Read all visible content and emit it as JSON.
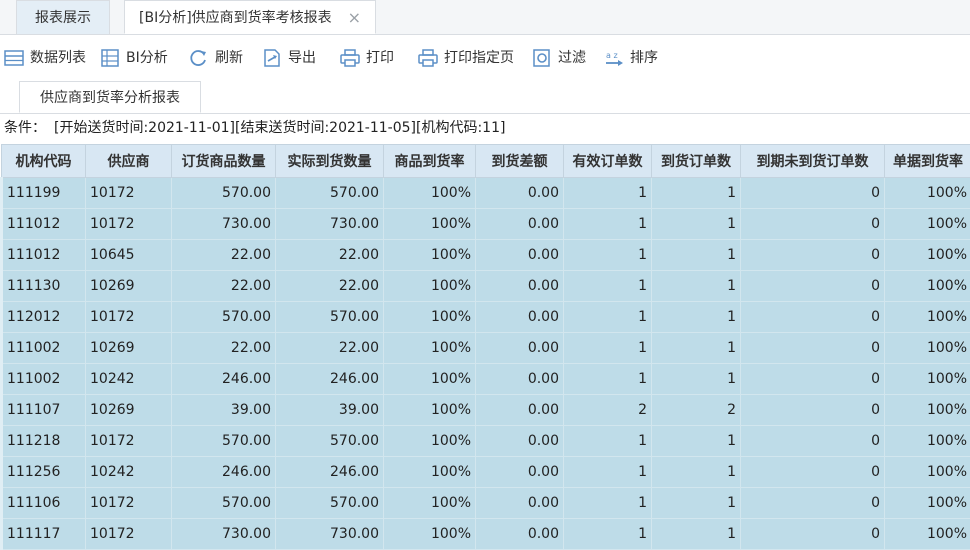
{
  "tabs": [
    {
      "label": "报表展示"
    },
    {
      "label": "[BI分析]供应商到货率考核报表",
      "close": "×"
    }
  ],
  "toolbar": {
    "items": [
      {
        "label": "数据列表",
        "icon": "table-list-icon"
      },
      {
        "label": "BI分析",
        "icon": "grid-icon"
      },
      {
        "label": "刷新",
        "icon": "refresh-icon"
      },
      {
        "label": "导出",
        "icon": "export-icon"
      },
      {
        "label": "打印",
        "icon": "print-icon"
      },
      {
        "label": "打印指定页",
        "icon": "print-pages-icon"
      },
      {
        "label": "过滤",
        "icon": "filter-icon"
      },
      {
        "label": "排序",
        "icon": "sort-icon"
      }
    ]
  },
  "subtab": {
    "label": "供应商到货率分析报表"
  },
  "condition": {
    "label": "条件：",
    "text": "[开始送货时间:2021-11-01][结束送货时间:2021-11-05][机构代码:11]"
  },
  "table": {
    "columns": [
      "机构代码",
      "供应商",
      "订货商品数量",
      "实际到货数量",
      "商品到货率",
      "到货差额",
      "有效订单数",
      "到货订单数",
      "到期未到货订单数",
      "单据到货率"
    ],
    "rows": [
      [
        "111199",
        "10172",
        "570.00",
        "570.00",
        "100%",
        "0.00",
        "1",
        "1",
        "0",
        "100%"
      ],
      [
        "111012",
        "10172",
        "730.00",
        "730.00",
        "100%",
        "0.00",
        "1",
        "1",
        "0",
        "100%"
      ],
      [
        "111012",
        "10645",
        "22.00",
        "22.00",
        "100%",
        "0.00",
        "1",
        "1",
        "0",
        "100%"
      ],
      [
        "111130",
        "10269",
        "22.00",
        "22.00",
        "100%",
        "0.00",
        "1",
        "1",
        "0",
        "100%"
      ],
      [
        "112012",
        "10172",
        "570.00",
        "570.00",
        "100%",
        "0.00",
        "1",
        "1",
        "0",
        "100%"
      ],
      [
        "111002",
        "10269",
        "22.00",
        "22.00",
        "100%",
        "0.00",
        "1",
        "1",
        "0",
        "100%"
      ],
      [
        "111002",
        "10242",
        "246.00",
        "246.00",
        "100%",
        "0.00",
        "1",
        "1",
        "0",
        "100%"
      ],
      [
        "111107",
        "10269",
        "39.00",
        "39.00",
        "100%",
        "0.00",
        "2",
        "2",
        "0",
        "100%"
      ],
      [
        "111218",
        "10172",
        "570.00",
        "570.00",
        "100%",
        "0.00",
        "1",
        "1",
        "0",
        "100%"
      ],
      [
        "111256",
        "10242",
        "246.00",
        "246.00",
        "100%",
        "0.00",
        "1",
        "1",
        "0",
        "100%"
      ],
      [
        "111106",
        "10172",
        "570.00",
        "570.00",
        "100%",
        "0.00",
        "1",
        "1",
        "0",
        "100%"
      ],
      [
        "111117",
        "10172",
        "730.00",
        "730.00",
        "100%",
        "0.00",
        "1",
        "1",
        "0",
        "100%"
      ]
    ]
  },
  "colors": {
    "header_bg": "#d8e7f3",
    "row_bg": "#bedce8",
    "icon_blue": "#5b8fc7"
  }
}
